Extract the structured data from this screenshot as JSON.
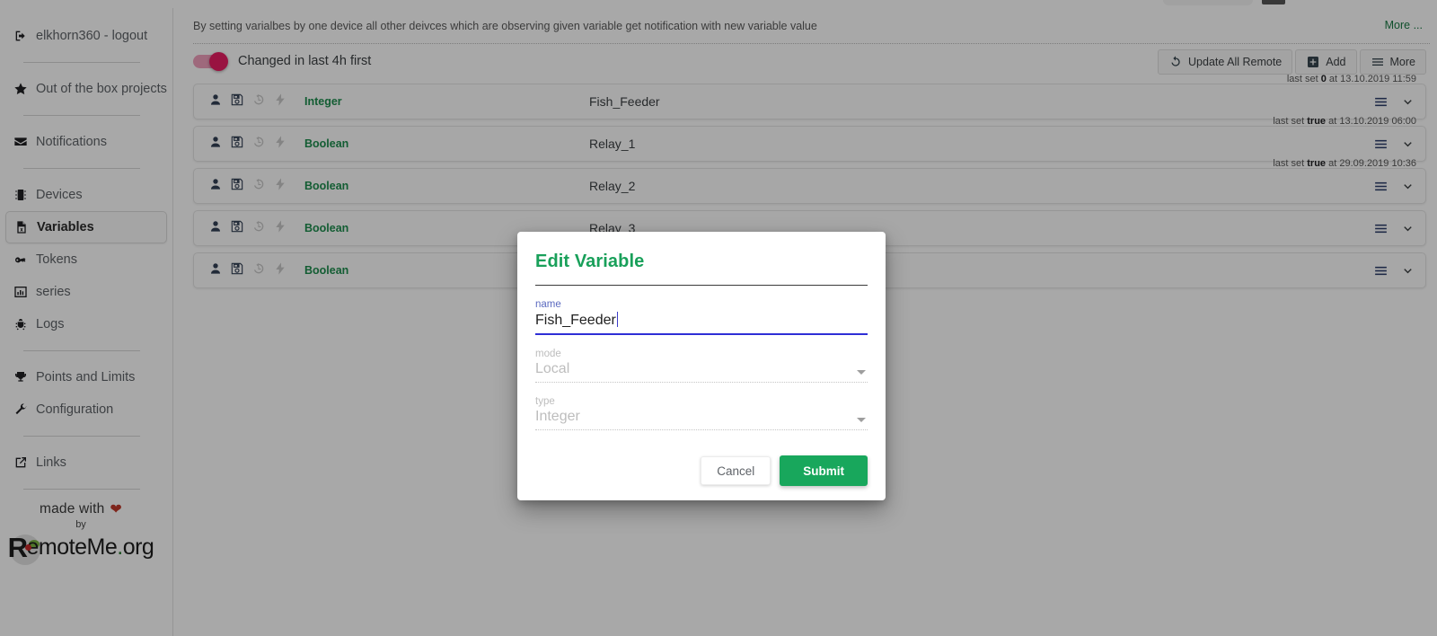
{
  "sidebar": {
    "items": [
      {
        "label": "elkhorn360 - logout",
        "icon": "logout-icon",
        "active": false,
        "sep_after": true
      },
      {
        "label": "Out of the box projects",
        "icon": "star-icon",
        "active": false,
        "sep_after": true
      },
      {
        "label": "Notifications",
        "icon": "envelope-icon",
        "active": false,
        "sep_after": true
      },
      {
        "label": "Devices",
        "icon": "chip-icon",
        "active": false,
        "sep_after": false
      },
      {
        "label": "Variables",
        "icon": "variables-icon",
        "active": true,
        "sep_after": false
      },
      {
        "label": "Tokens",
        "icon": "key-icon",
        "active": false,
        "sep_after": false
      },
      {
        "label": "series",
        "icon": "chart-bar-icon",
        "active": false,
        "sep_after": false
      },
      {
        "label": "Logs",
        "icon": "bug-icon",
        "active": false,
        "sep_after": true
      },
      {
        "label": "Points and Limits",
        "icon": "trophy-icon",
        "active": false,
        "sep_after": false
      },
      {
        "label": "Configuration",
        "icon": "wrench-icon",
        "active": false,
        "sep_after": true
      },
      {
        "label": "Links",
        "icon": "external-link-icon",
        "active": false,
        "sep_after": true
      }
    ],
    "footer": {
      "made_with": "made with",
      "heart": "❤",
      "by": "by",
      "brand_initial": "R",
      "brand_rest": "emoteMe",
      "brand_dot": ".",
      "brand_tld": "org"
    }
  },
  "main": {
    "description": "By setting varialbes by one device all other deivces which are observing given variable get notification with new variable value",
    "more_link": "More ...",
    "toggle": {
      "label": "Changed in last 4h first",
      "on": true,
      "color": "#e91e63"
    },
    "buttons": [
      {
        "label": "Update All Remote",
        "icon": "refresh-icon"
      },
      {
        "label": "Add",
        "icon": "plus-square-icon"
      },
      {
        "label": "More",
        "icon": "hamburger-icon"
      }
    ],
    "rows": [
      {
        "type": "Integer",
        "name": "Fish_Feeder",
        "last_set_prefix": "last set",
        "last_set_value": "0",
        "last_set_mid": "at",
        "last_set_time": "13.10.2019 11:59"
      },
      {
        "type": "Boolean",
        "name": "Relay_1",
        "last_set_prefix": "last set",
        "last_set_value": "true",
        "last_set_mid": "at",
        "last_set_time": "13.10.2019 06:00"
      },
      {
        "type": "Boolean",
        "name": "Relay_2",
        "last_set_prefix": "last set",
        "last_set_value": "true",
        "last_set_mid": "at",
        "last_set_time": "29.09.2019 10:36"
      },
      {
        "type": "Boolean",
        "name": "Relay_3",
        "last_set_prefix": "",
        "last_set_value": "",
        "last_set_mid": "",
        "last_set_time": ""
      },
      {
        "type": "Boolean",
        "name": "",
        "last_set_prefix": "",
        "last_set_value": "",
        "last_set_mid": "",
        "last_set_time": ""
      }
    ],
    "row_icons": [
      "user-icon",
      "save-icon",
      "history-icon",
      "lightning-icon"
    ]
  },
  "modal": {
    "title": "Edit Variable",
    "name_label": "name",
    "name_value": "Fish_Feeder",
    "mode_label": "mode",
    "mode_value": "Local",
    "type_label": "type",
    "type_value": "Integer",
    "cancel_label": "Cancel",
    "submit_label": "Submit",
    "accent_green": "#18a75c",
    "focus_blue": "#2f2fd6"
  }
}
